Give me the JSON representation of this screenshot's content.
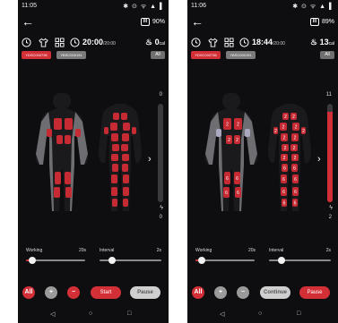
{
  "screens": [
    {
      "status": {
        "time": "11:05",
        "icons": "✱ ⊙ ᯤ ▲ ▌"
      },
      "battery": {
        "icon_label": "III",
        "percent": "90%"
      },
      "timer": {
        "elapsed": "20:00",
        "total": "/20:00"
      },
      "calories": {
        "value": "0",
        "unit": "cal"
      },
      "suits": [
        "YDSC000736",
        "YBSC000191"
      ],
      "all_label": "All",
      "level": {
        "top": "0",
        "bottom": "0",
        "fill_fraction": 0.0
      },
      "working": {
        "label": "Working",
        "value": "20s",
        "fraction": 0.1
      },
      "interval": {
        "label": "Interval",
        "value": "2s",
        "fraction": 0.0
      },
      "buttons": {
        "all": "All",
        "plus": "+",
        "minus": "−",
        "action": "Start",
        "pause": "Pause"
      },
      "pads": {
        "front": [],
        "back": []
      }
    },
    {
      "status": {
        "time": "11:06",
        "icons": "✱ ⊙ ᯤ ▲ ▌"
      },
      "battery": {
        "icon_label": "III",
        "percent": "89%"
      },
      "timer": {
        "elapsed": "18:44",
        "total": "/20:00"
      },
      "calories": {
        "value": "13",
        "unit": "cal"
      },
      "suits": [
        "YDSC000736",
        "YBSC000191"
      ],
      "all_label": "All",
      "level": {
        "top": "11",
        "bottom": "2",
        "fill_fraction": 0.92
      },
      "working": {
        "label": "Working",
        "value": "20s",
        "fraction": 0.1
      },
      "interval": {
        "label": "Interval",
        "value": "2s",
        "fraction": 0.0
      },
      "buttons": {
        "all": "All",
        "plus": "+",
        "minus": "−",
        "action": "Continue",
        "pause": "Pause"
      },
      "pads": {
        "front": [
          "2",
          "2",
          "",
          "",
          "2",
          "2",
          "6",
          "6",
          "6",
          "6"
        ],
        "back": [
          "2",
          "2",
          "2",
          "2",
          "2",
          "2",
          "2",
          "2",
          "2",
          "2",
          "2",
          "2",
          "6",
          "6",
          "6",
          "6",
          "6",
          "6",
          "6",
          "6"
        ]
      }
    }
  ],
  "colors": {
    "accent": "#d32f37",
    "background": "#0e0e10",
    "suit_body": "#1a1a1d",
    "suit_side": "#8a8a8f",
    "pad_active": "#c62a33",
    "pad_blue": "#a8a8c0"
  },
  "icons": {
    "back": "arrow-left-icon",
    "toolbar": [
      "clock-icon",
      "shirt-icon",
      "grid-icon",
      "timer-icon",
      "calorie-icon"
    ],
    "charge": "bolt-icon",
    "next": "chevron-right-icon",
    "nav": [
      "back-triangle-icon",
      "home-circle-icon",
      "recents-square-icon"
    ]
  }
}
